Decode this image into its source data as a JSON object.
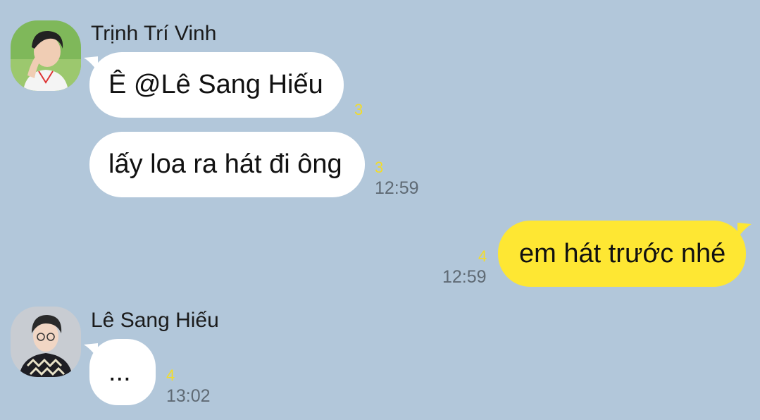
{
  "colors": {
    "background": "#b2c7da",
    "incoming_bubble": "#ffffff",
    "outgoing_bubble": "#fee733",
    "unread_count": "#f2dc2a",
    "timestamp": "#5f6a74"
  },
  "messages": {
    "group1": {
      "sender": "Trịnh Trí Vinh",
      "avatar_icon": "user-photo-icon",
      "m1": {
        "text": "Ê @Lê Sang Hiếu",
        "unread": "3"
      },
      "m2": {
        "text": "lấy loa ra hát đi ông",
        "unread": "3",
        "time": "12:59"
      }
    },
    "outgoing": {
      "m1": {
        "text": "em hát trước nhé",
        "unread": "4",
        "time": "12:59"
      }
    },
    "group2": {
      "sender": "Lê Sang Hiếu",
      "avatar_icon": "user-photo-icon",
      "m1": {
        "text": "...",
        "unread": "4",
        "time": "13:02"
      }
    }
  }
}
